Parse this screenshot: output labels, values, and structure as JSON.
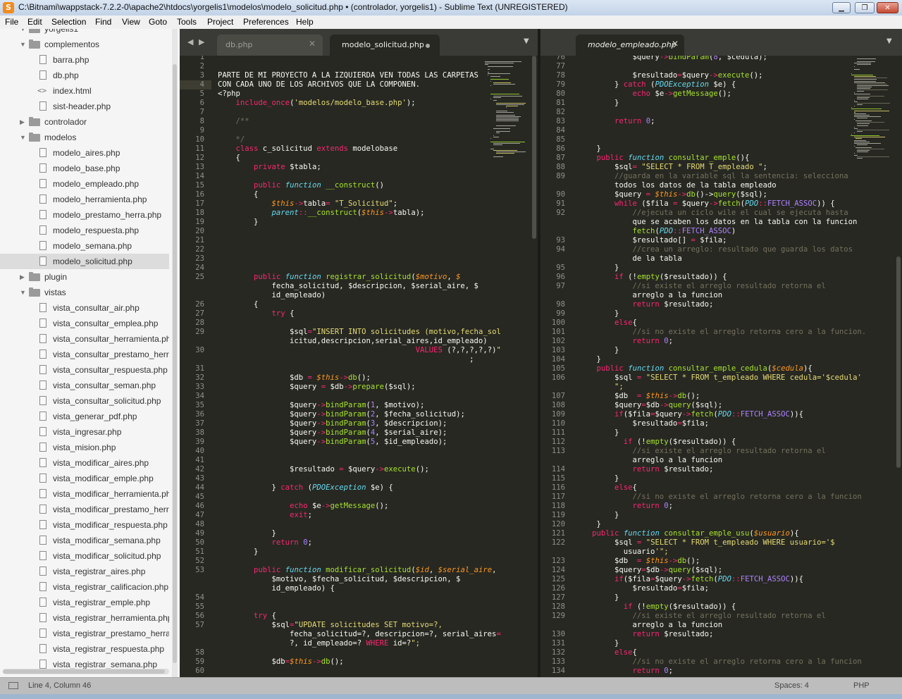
{
  "window": {
    "title": "C:\\Bitnami\\wappstack-7.2.2-0\\apache2\\htdocs\\yorgelis1\\modelos\\modelo_solicitud.php • (controlador, yorgelis1) - Sublime Text (UNREGISTERED)",
    "app_icon": "S",
    "minimize_icon": "minimize-icon",
    "maximize_icon": "maximize-icon",
    "close_icon": "close-icon",
    "minimize_glyph": "▁",
    "maximize_glyph": "❐",
    "close_glyph": "✕"
  },
  "menu": [
    "File",
    "Edit",
    "Selection",
    "Find",
    "View",
    "Goto",
    "Tools",
    "Project",
    "Preferences",
    "Help"
  ],
  "sidebar": {
    "items": [
      {
        "label": "yorgelis1",
        "kind": "folder",
        "depth": 1,
        "open": true
      },
      {
        "label": "complementos",
        "kind": "folder",
        "depth": 1,
        "open": true
      },
      {
        "label": "barra.php",
        "kind": "file",
        "depth": 2
      },
      {
        "label": "db.php",
        "kind": "file",
        "depth": 2
      },
      {
        "label": "index.html",
        "kind": "code",
        "depth": 2
      },
      {
        "label": "sist-header.php",
        "kind": "file",
        "depth": 2
      },
      {
        "label": "controlador",
        "kind": "folder",
        "depth": 1,
        "open": false
      },
      {
        "label": "modelos",
        "kind": "folder",
        "depth": 1,
        "open": true
      },
      {
        "label": "modelo_aires.php",
        "kind": "file",
        "depth": 2
      },
      {
        "label": "modelo_base.php",
        "kind": "file",
        "depth": 2
      },
      {
        "label": "modelo_empleado.php",
        "kind": "file",
        "depth": 2
      },
      {
        "label": "modelo_herramienta.php",
        "kind": "file",
        "depth": 2
      },
      {
        "label": "modelo_prestamo_herra.php",
        "kind": "file",
        "depth": 2
      },
      {
        "label": "modelo_respuesta.php",
        "kind": "file",
        "depth": 2
      },
      {
        "label": "modelo_semana.php",
        "kind": "file",
        "depth": 2
      },
      {
        "label": "modelo_solicitud.php",
        "kind": "file",
        "depth": 2,
        "selected": true
      },
      {
        "label": "plugin",
        "kind": "folder",
        "depth": 1,
        "open": false
      },
      {
        "label": "vistas",
        "kind": "folder",
        "depth": 1,
        "open": true
      },
      {
        "label": "vista_consultar_air.php",
        "kind": "file",
        "depth": 2
      },
      {
        "label": "vista_consultar_emplea.php",
        "kind": "file",
        "depth": 2
      },
      {
        "label": "vista_consultar_herramienta.php",
        "kind": "file",
        "depth": 2
      },
      {
        "label": "vista_consultar_prestamo_herra",
        "kind": "file",
        "depth": 2
      },
      {
        "label": "vista_consultar_respuesta.php",
        "kind": "file",
        "depth": 2
      },
      {
        "label": "vista_consultar_seman.php",
        "kind": "file",
        "depth": 2
      },
      {
        "label": "vista_consultar_solicitud.php",
        "kind": "file",
        "depth": 2
      },
      {
        "label": "vista_generar_pdf.php",
        "kind": "file",
        "depth": 2
      },
      {
        "label": "vista_ingresar.php",
        "kind": "file",
        "depth": 2
      },
      {
        "label": "vista_mision.php",
        "kind": "file",
        "depth": 2
      },
      {
        "label": "vista_modificar_aires.php",
        "kind": "file",
        "depth": 2
      },
      {
        "label": "vista_modificar_emple.php",
        "kind": "file",
        "depth": 2
      },
      {
        "label": "vista_modificar_herramienta.ph",
        "kind": "file",
        "depth": 2
      },
      {
        "label": "vista_modificar_prestamo_herra",
        "kind": "file",
        "depth": 2
      },
      {
        "label": "vista_modificar_respuesta.php",
        "kind": "file",
        "depth": 2
      },
      {
        "label": "vista_modificar_semana.php",
        "kind": "file",
        "depth": 2
      },
      {
        "label": "vista_modificar_solicitud.php",
        "kind": "file",
        "depth": 2
      },
      {
        "label": "vista_registrar_aires.php",
        "kind": "file",
        "depth": 2
      },
      {
        "label": "vista_registrar_calificacion.php",
        "kind": "file",
        "depth": 2
      },
      {
        "label": "vista_registrar_emple.php",
        "kind": "file",
        "depth": 2
      },
      {
        "label": "vista_registrar_herramienta.php",
        "kind": "file",
        "depth": 2
      },
      {
        "label": "vista_registrar_prestamo_herra.",
        "kind": "file",
        "depth": 2
      },
      {
        "label": "vista_registrar_respuesta.php",
        "kind": "file",
        "depth": 2
      },
      {
        "label": "vista_registrar_semana.php",
        "kind": "file",
        "depth": 2
      }
    ]
  },
  "tabs_left": [
    {
      "label": "db.php",
      "active": false,
      "close": "✕"
    },
    {
      "label": "modelo_solicitud.php",
      "active": true,
      "dirty": true
    }
  ],
  "tabs_right": [
    {
      "label": "modelo_empleado.php",
      "active": true,
      "close": "✕"
    }
  ],
  "tab_arrows": {
    "left": "◀",
    "right": "▶",
    "dropdown": "▼"
  },
  "editor_left": {
    "current_line": "4",
    "lines": [
      {
        "n": "1",
        "t": ""
      },
      {
        "n": "2",
        "t": ""
      },
      {
        "n": "3",
        "t": "PARTE DE MI PROYECTO A LA IZQUIERDA VEN TODAS LAS CARPETAS"
      },
      {
        "n": "4",
        "t": "CON CADA UNO DE LOS ARCHIVOS QUE LA COMPONEN."
      },
      {
        "n": "5",
        "t": "<?php"
      },
      {
        "n": "6",
        "t": "    include_once('modelos/modelo_base.php');"
      },
      {
        "n": "7",
        "t": ""
      },
      {
        "n": "8",
        "t": "    /**"
      },
      {
        "n": "9",
        "t": ""
      },
      {
        "n": "10",
        "t": "    */"
      },
      {
        "n": "11",
        "t": "    class c_solicitud extends modelobase"
      },
      {
        "n": "12",
        "t": "    {"
      },
      {
        "n": "13",
        "t": "        private $tabla;"
      },
      {
        "n": "14",
        "t": ""
      },
      {
        "n": "15",
        "t": "        public function __construct()"
      },
      {
        "n": "16",
        "t": "        {"
      },
      {
        "n": "17",
        "t": "            $this->tabla= \"T_Solicitud\";"
      },
      {
        "n": "18",
        "t": "            parent::__construct($this->tabla);"
      },
      {
        "n": "19",
        "t": "        }"
      },
      {
        "n": "20",
        "t": ""
      },
      {
        "n": "21",
        "t": ""
      },
      {
        "n": "22",
        "t": ""
      },
      {
        "n": "23",
        "t": ""
      },
      {
        "n": "24",
        "t": ""
      },
      {
        "n": "25",
        "t": "        public function registrar_solicitud($motivo, $"
      },
      {
        "n": "",
        "t": "            fecha_solicitud, $descripcion, $serial_aire, $"
      },
      {
        "n": "",
        "t": "            id_empleado)"
      },
      {
        "n": "26",
        "t": "        {"
      },
      {
        "n": "27",
        "t": "            try {"
      },
      {
        "n": "28",
        "t": ""
      },
      {
        "n": "29",
        "t": "                $sql=\"INSERT INTO solicitudes (motivo,fecha_sol"
      },
      {
        "n": "",
        "t": "                icitud,descripcion,serial_aires,id_empleado)"
      },
      {
        "n": "30",
        "t": "                                            VALUES (?,?,?,?,?)\""
      },
      {
        "n": "",
        "t": "                                                        ;"
      },
      {
        "n": "31",
        "t": ""
      },
      {
        "n": "32",
        "t": "                $db = $this->db();"
      },
      {
        "n": "33",
        "t": "                $query = $db->prepare($sql);"
      },
      {
        "n": "34",
        "t": ""
      },
      {
        "n": "35",
        "t": "                $query->bindParam(1, $motivo);"
      },
      {
        "n": "36",
        "t": "                $query->bindParam(2, $fecha_solicitud);"
      },
      {
        "n": "37",
        "t": "                $query->bindParam(3, $descripcion);"
      },
      {
        "n": "38",
        "t": "                $query->bindParam(4, $serial_aire);"
      },
      {
        "n": "39",
        "t": "                $query->bindParam(5, $id_empleado);"
      },
      {
        "n": "40",
        "t": ""
      },
      {
        "n": "41",
        "t": ""
      },
      {
        "n": "42",
        "t": "                $resultado = $query->execute();"
      },
      {
        "n": "43",
        "t": ""
      },
      {
        "n": "44",
        "t": "            } catch (PDOException $e) {"
      },
      {
        "n": "45",
        "t": ""
      },
      {
        "n": "46",
        "t": "                echo $e->getMessage();"
      },
      {
        "n": "47",
        "t": "                exit;"
      },
      {
        "n": "48",
        "t": ""
      },
      {
        "n": "49",
        "t": "            }"
      },
      {
        "n": "50",
        "t": "            return 0;"
      },
      {
        "n": "51",
        "t": "        }"
      },
      {
        "n": "52",
        "t": ""
      },
      {
        "n": "53",
        "t": "        public function modificar_solicitud($id, $serial_aire,"
      },
      {
        "n": "",
        "t": "            $motivo, $fecha_solicitud, $descripcion, $"
      },
      {
        "n": "",
        "t": "            id_empleado) {"
      },
      {
        "n": "54",
        "t": ""
      },
      {
        "n": "55",
        "t": ""
      },
      {
        "n": "56",
        "t": "        try {"
      },
      {
        "n": "57",
        "t": "            $sql=\"UPDATE solicitudes SET motivo=?,"
      },
      {
        "n": "",
        "t": "                fecha_solicitud=?, descripcion=?, serial_aires="
      },
      {
        "n": "",
        "t": "                ?, id_empleado=? WHERE id=?\";"
      },
      {
        "n": "58",
        "t": ""
      },
      {
        "n": "59",
        "t": "            $db=$this->db();"
      },
      {
        "n": "60",
        "t": ""
      }
    ]
  },
  "editor_right": {
    "lines": [
      {
        "n": "76",
        "t": "            $query->bindParam(8, $cedula);"
      },
      {
        "n": "77",
        "t": ""
      },
      {
        "n": "78",
        "t": "            $resultado=$query->execute();"
      },
      {
        "n": "79",
        "t": "        } catch (PDOException $e) {"
      },
      {
        "n": "80",
        "t": "            echo $e->getMessage();"
      },
      {
        "n": "81",
        "t": "        }"
      },
      {
        "n": "82",
        "t": ""
      },
      {
        "n": "83",
        "t": "        return 0;"
      },
      {
        "n": "84",
        "t": ""
      },
      {
        "n": "85",
        "t": ""
      },
      {
        "n": "86",
        "t": "    }"
      },
      {
        "n": "87",
        "t": "    public function consultar_emple(){"
      },
      {
        "n": "88",
        "t": "        $sql= \"SELECT * FROM T_empleado \";"
      },
      {
        "n": "89",
        "t": "        //guarda en la variable sql la sentencia: selecciona"
      },
      {
        "n": "",
        "t": "        todos los datos de la tabla empleado"
      },
      {
        "n": "90",
        "t": "        $query = $this->db()->query($sql);"
      },
      {
        "n": "91",
        "t": "        while ($fila = $query->fetch(PDO::FETCH_ASSOC)) {"
      },
      {
        "n": "92",
        "t": "            //ejecuta un ciclo wile el cual se ejecuta hasta"
      },
      {
        "n": "",
        "t": "            que se acaben los datos en la tabla con la funcion"
      },
      {
        "n": "",
        "t": "            fetch(PDO::FETCH_ASSOC)"
      },
      {
        "n": "93",
        "t": "            $resultado[] = $fila;"
      },
      {
        "n": "94",
        "t": "            //crea un arreglo: resultado que guarda los datos"
      },
      {
        "n": "",
        "t": "            de la tabla"
      },
      {
        "n": "95",
        "t": "        }"
      },
      {
        "n": "96",
        "t": "        if (!empty($resultado)) {"
      },
      {
        "n": "97",
        "t": "            //si existe el arreglo resultado retorna el"
      },
      {
        "n": "",
        "t": "            arreglo a la funcion"
      },
      {
        "n": "98",
        "t": "            return $resultado;"
      },
      {
        "n": "99",
        "t": "        }"
      },
      {
        "n": "100",
        "t": "        else{"
      },
      {
        "n": "101",
        "t": "            //si no existe el arreglo retorna cero a la funcion."
      },
      {
        "n": "102",
        "t": "            return 0;"
      },
      {
        "n": "103",
        "t": "        }"
      },
      {
        "n": "104",
        "t": "    }"
      },
      {
        "n": "105",
        "t": "    public function consultar_emple_cedula($cedula){"
      },
      {
        "n": "106",
        "t": "        $sql = \"SELECT * FROM t_empleado WHERE cedula='$cedula'"
      },
      {
        "n": "",
        "t": "        \";"
      },
      {
        "n": "107",
        "t": "        $db  = $this->db();"
      },
      {
        "n": "108",
        "t": "        $query=$db->query($sql);"
      },
      {
        "n": "109",
        "t": "        if($fila=$query->fetch(PDO::FETCH_ASSOC)){"
      },
      {
        "n": "110",
        "t": "            $resultado=$fila;"
      },
      {
        "n": "111",
        "t": "        }"
      },
      {
        "n": "112",
        "t": "          if (!empty($resultado)) {"
      },
      {
        "n": "113",
        "t": "            //si existe el arreglo resultado retorna el"
      },
      {
        "n": "",
        "t": "            arreglo a la funcion"
      },
      {
        "n": "114",
        "t": "            return $resultado;"
      },
      {
        "n": "115",
        "t": "        }"
      },
      {
        "n": "116",
        "t": "        else{"
      },
      {
        "n": "117",
        "t": "            //si no existe el arreglo retorna cero a la funcion"
      },
      {
        "n": "118",
        "t": "            return 0;"
      },
      {
        "n": "119",
        "t": "        }"
      },
      {
        "n": "120",
        "t": "    }"
      },
      {
        "n": "121",
        "t": "   public function consultar_emple_usu($usuario){"
      },
      {
        "n": "122",
        "t": "        $sql = \"SELECT * FROM t_empleado WHERE usuario='$"
      },
      {
        "n": "",
        "t": "          usuario'\";"
      },
      {
        "n": "123",
        "t": "        $db  = $this->db();"
      },
      {
        "n": "124",
        "t": "        $query=$db->query($sql);"
      },
      {
        "n": "125",
        "t": "        if($fila=$query->fetch(PDO::FETCH_ASSOC)){"
      },
      {
        "n": "126",
        "t": "            $resultado=$fila;"
      },
      {
        "n": "127",
        "t": "        }"
      },
      {
        "n": "128",
        "t": "          if (!empty($resultado)) {"
      },
      {
        "n": "129",
        "t": "            //si existe el arreglo resultado retorna el"
      },
      {
        "n": "",
        "t": "            arreglo a la funcion"
      },
      {
        "n": "130",
        "t": "            return $resultado;"
      },
      {
        "n": "131",
        "t": "        }"
      },
      {
        "n": "132",
        "t": "        else{"
      },
      {
        "n": "133",
        "t": "            //si no existe el arreglo retorna cero a la funcion"
      },
      {
        "n": "134",
        "t": "            return 0;"
      }
    ]
  },
  "status": {
    "position": "Line 4, Column 46",
    "indent": "Spaces: 4",
    "syntax": "PHP"
  },
  "colors": {
    "editor_bg": "#272822",
    "sidebar_bg": "#f5f5f5",
    "keyword": "#f92672",
    "string": "#e6db74",
    "function": "#a6e22e",
    "variable": "#fd971f",
    "comment": "#75715e",
    "number": "#ae81ff",
    "storage": "#66d9ef"
  }
}
